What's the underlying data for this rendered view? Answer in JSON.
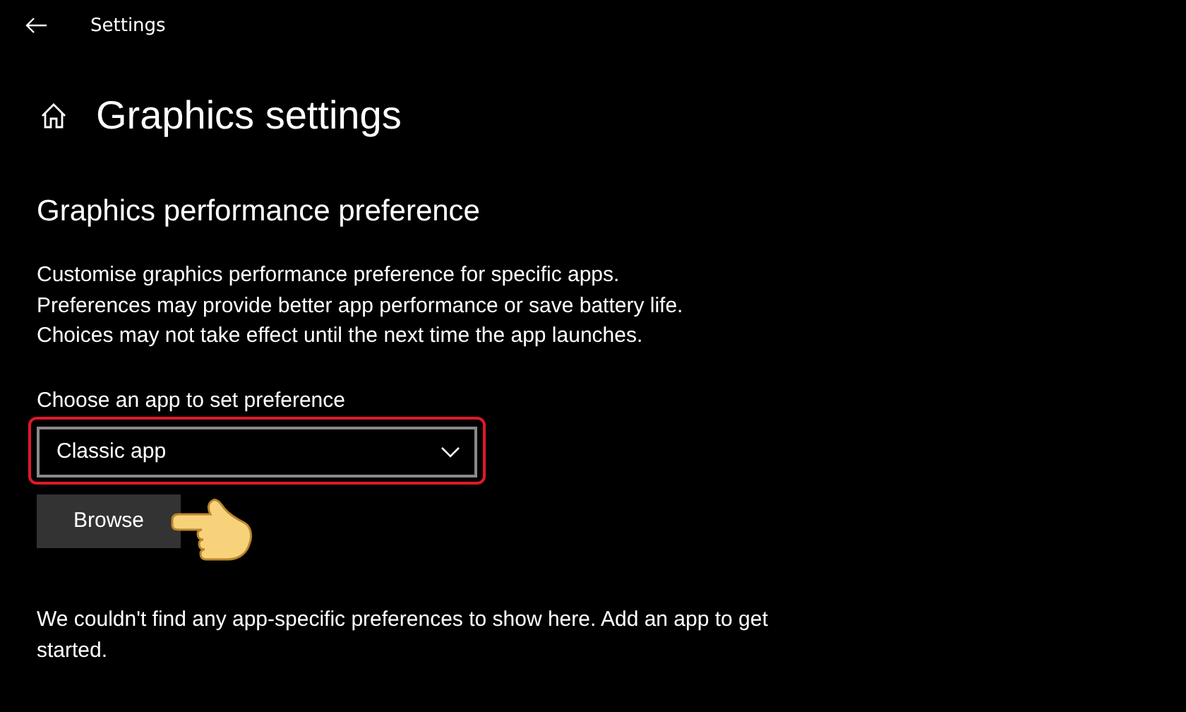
{
  "window": {
    "title": "Settings"
  },
  "page": {
    "title": "Graphics settings"
  },
  "section": {
    "heading": "Graphics performance preference",
    "description": [
      "Customise graphics performance preference for specific apps.",
      "Preferences may provide better app performance or save battery life.",
      "Choices may not take effect until the next time the app launches."
    ],
    "dropdown_label": "Choose an app to set preference",
    "dropdown": {
      "value": "Classic app",
      "highlighted": true
    },
    "browse_button": "Browse",
    "empty_message": "We couldn't find any app-specific preferences to show here. Add an app to get started."
  }
}
